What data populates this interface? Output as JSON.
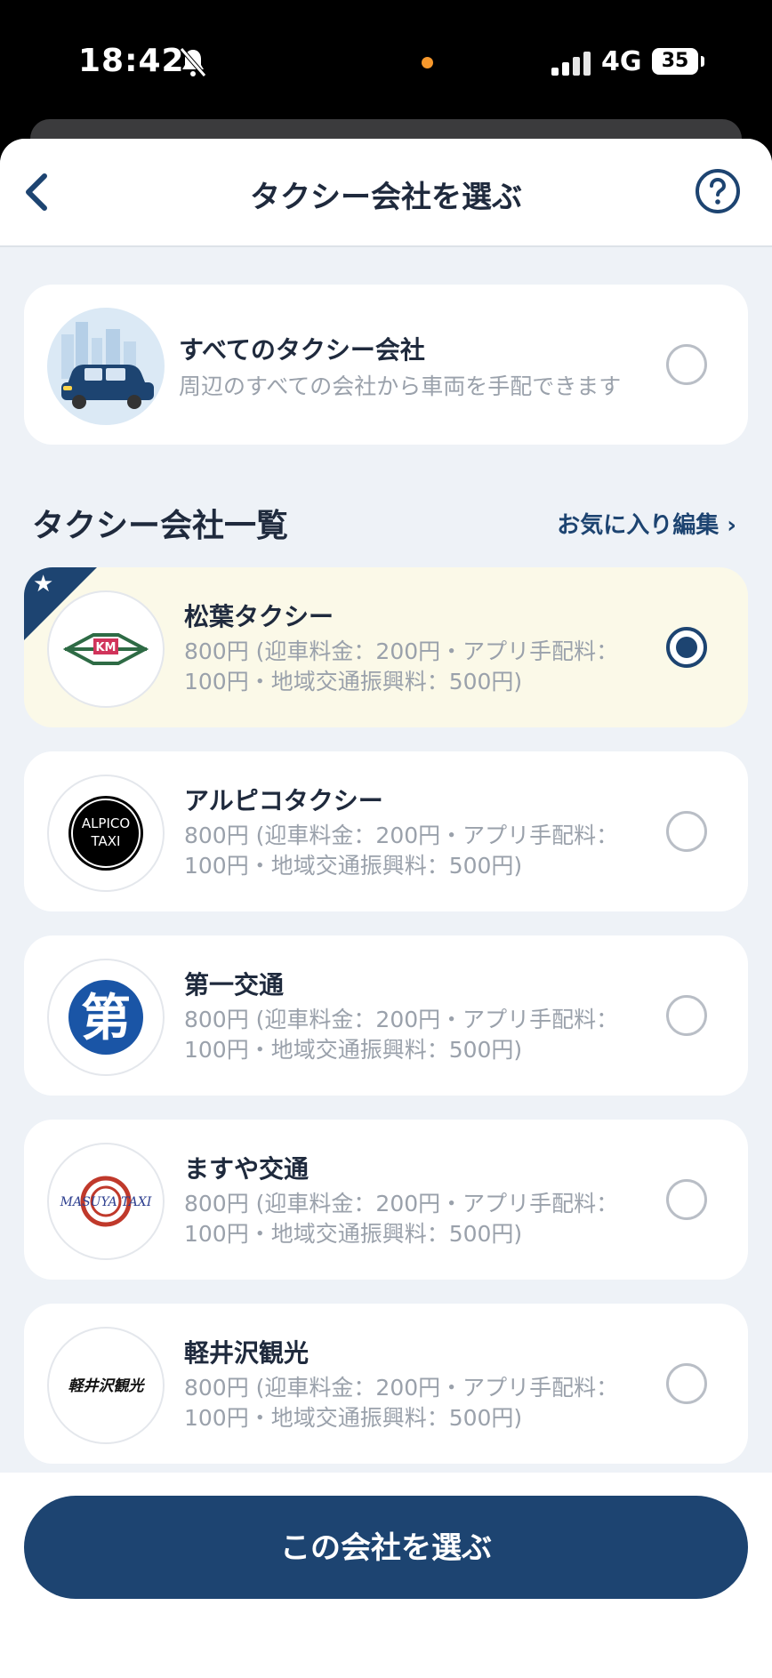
{
  "status_bar": {
    "time": "18:42",
    "network": "4G",
    "battery": "35"
  },
  "header": {
    "title": "タクシー会社を選ぶ"
  },
  "all_companies": {
    "name": "すべてのタクシー会社",
    "description": "周辺のすべての会社から車両を手配できます",
    "selected": false
  },
  "list_section": {
    "title": "タクシー会社一覧",
    "edit_favorites": "お気に入り編集 ›"
  },
  "companies": [
    {
      "name": "松葉タクシー",
      "fare": "800円 (迎車料金：200円・アプリ手配料：100円・地域交通振興料：500円)",
      "selected": true,
      "favorite": true,
      "logo_text": "KM"
    },
    {
      "name": "アルピコタクシー",
      "fare": "800円 (迎車料金：200円・アプリ手配料：100円・地域交通振興料：500円)",
      "selected": false,
      "favorite": false,
      "logo_text": "ALPICO TAXI"
    },
    {
      "name": "第一交通",
      "fare": "800円 (迎車料金：200円・アプリ手配料：100円・地域交通振興料：500円)",
      "selected": false,
      "favorite": false,
      "logo_text": "第"
    },
    {
      "name": "ますや交通",
      "fare": "800円 (迎車料金：200円・アプリ手配料：100円・地域交通振興料：500円)",
      "selected": false,
      "favorite": false,
      "logo_text": "MASUYA TAXI"
    },
    {
      "name": "軽井沢観光",
      "fare": "800円 (迎車料金：200円・アプリ手配料：100円・地域交通振興料：500円)",
      "selected": false,
      "favorite": false,
      "logo_text": "軽井沢観光"
    }
  ],
  "cta": {
    "label": "この会社を選ぶ"
  },
  "colors": {
    "primary": "#1d4471",
    "selected_bg": "#fbf9e8",
    "background": "#eef2f7",
    "status_dot": "#f7982c"
  }
}
